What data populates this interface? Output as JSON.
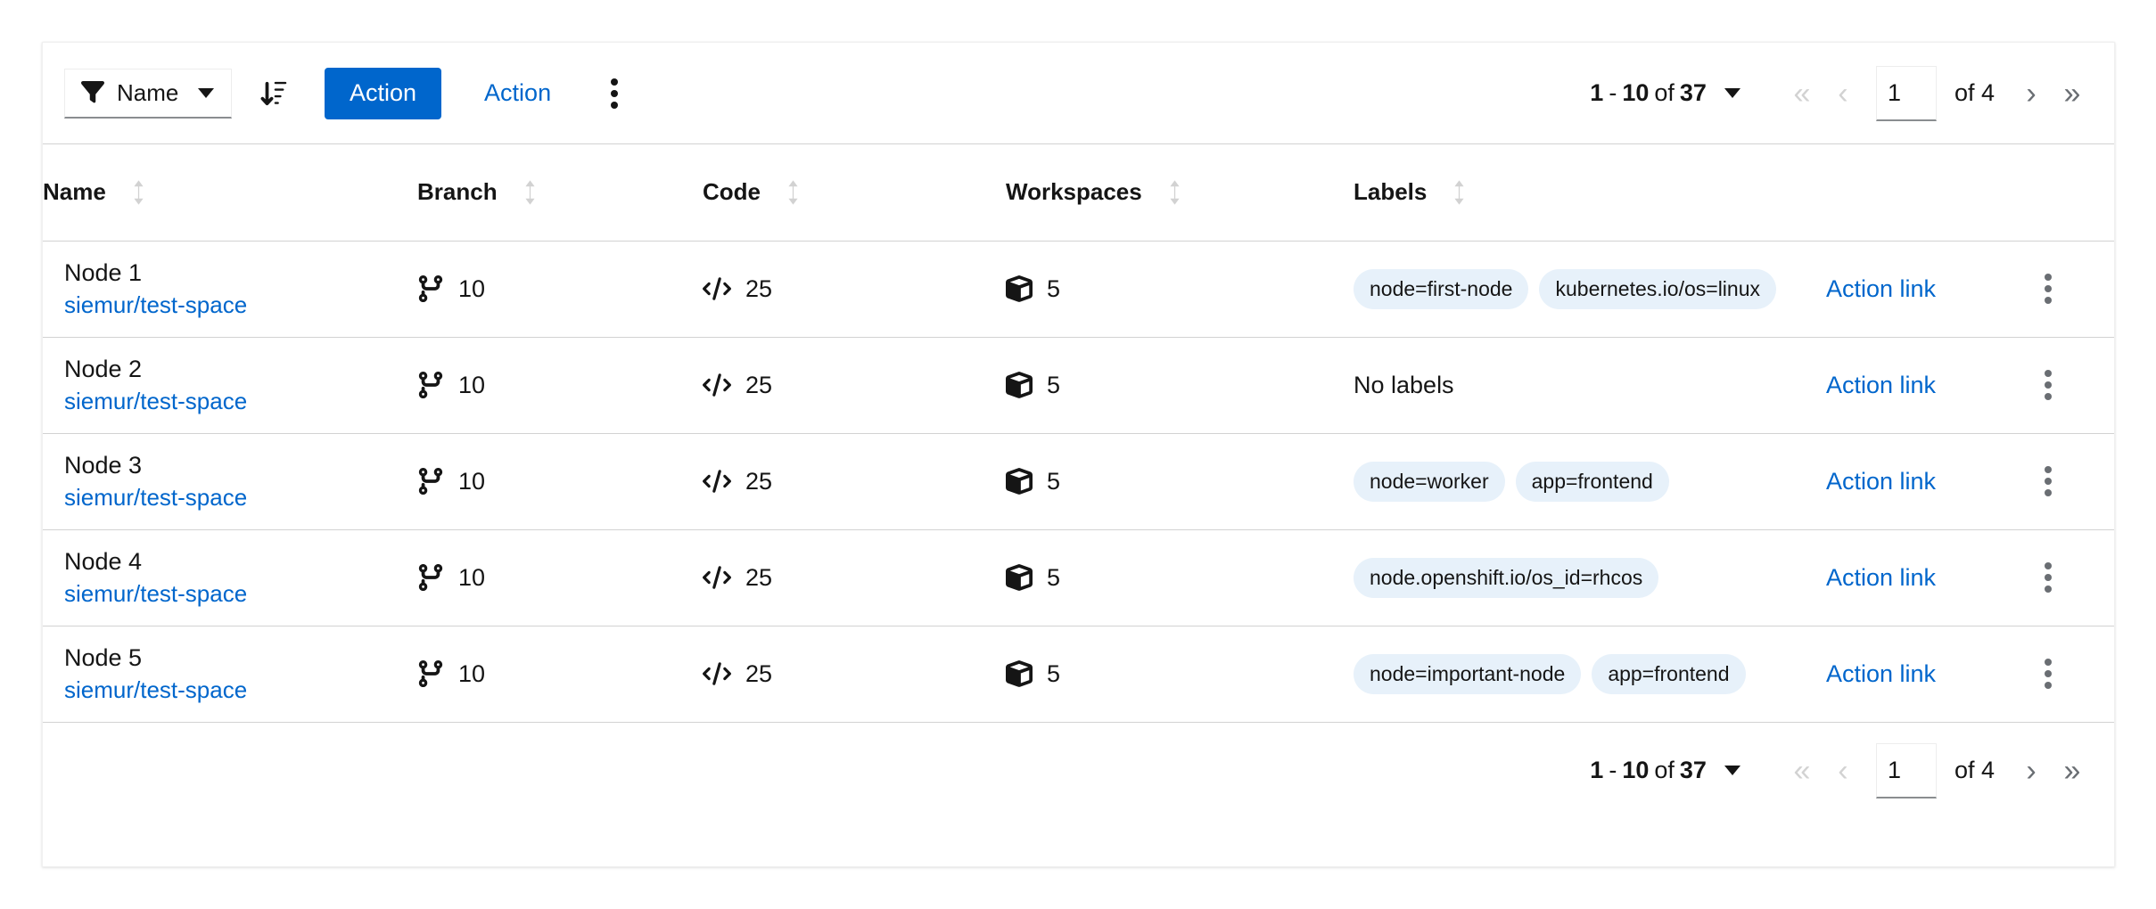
{
  "toolbar": {
    "filter": {
      "icon": "filter-icon",
      "label": "Name",
      "caret": "chevron-down-icon"
    },
    "sort_icon": "sort-amount-down-icon",
    "primary_action_label": "Action",
    "secondary_action_label": "Action",
    "kebab_icon": "kebab-vertical-icon"
  },
  "pagination": {
    "range_start": "1",
    "range_dash": "-",
    "range_end": "10",
    "of_word": "of",
    "total": "37",
    "first_icon": "angle-double-left-icon",
    "prev_icon": "angle-left-icon",
    "page_value": "1",
    "page_of": "of 4",
    "next_icon": "angle-right-icon",
    "last_icon": "angle-double-right-icon"
  },
  "table": {
    "columns": [
      {
        "label": "Name",
        "sortable": true
      },
      {
        "label": "Branch",
        "sortable": true
      },
      {
        "label": "Code",
        "sortable": true
      },
      {
        "label": "Workspaces",
        "sortable": true
      },
      {
        "label": "Labels",
        "sortable": true
      }
    ],
    "rows": [
      {
        "name": "Node 1",
        "repo": "siemur/test-space",
        "branch": "10",
        "code": "25",
        "workspaces": "5",
        "labels": [
          "node=first-node",
          "kubernetes.io/os=linux"
        ],
        "no_labels_text": "",
        "action": "Action link"
      },
      {
        "name": "Node 2",
        "repo": "siemur/test-space",
        "branch": "10",
        "code": "25",
        "workspaces": "5",
        "labels": [],
        "no_labels_text": "No labels",
        "action": "Action link"
      },
      {
        "name": "Node 3",
        "repo": "siemur/test-space",
        "branch": "10",
        "code": "25",
        "workspaces": "5",
        "labels": [
          "node=worker",
          "app=frontend"
        ],
        "no_labels_text": "",
        "action": "Action link"
      },
      {
        "name": "Node 4",
        "repo": "siemur/test-space",
        "branch": "10",
        "code": "25",
        "workspaces": "5",
        "labels": [
          "node.openshift.io/os_id=rhcos"
        ],
        "no_labels_text": "",
        "action": "Action link"
      },
      {
        "name": "Node 5",
        "repo": "siemur/test-space",
        "branch": "10",
        "code": "25",
        "workspaces": "5",
        "labels": [
          "node=important-node",
          "app=frontend"
        ],
        "no_labels_text": "",
        "action": "Action link"
      }
    ],
    "row_icons": {
      "branch": "code-branch-icon",
      "code": "code-icon",
      "workspaces": "cube-icon",
      "kebab": "kebab-vertical-icon"
    }
  },
  "colors": {
    "accent": "#0066cc",
    "chip_bg": "#e7f1fa",
    "border": "#d2d2d2",
    "text": "#151515",
    "muted": "#6a6e73"
  }
}
